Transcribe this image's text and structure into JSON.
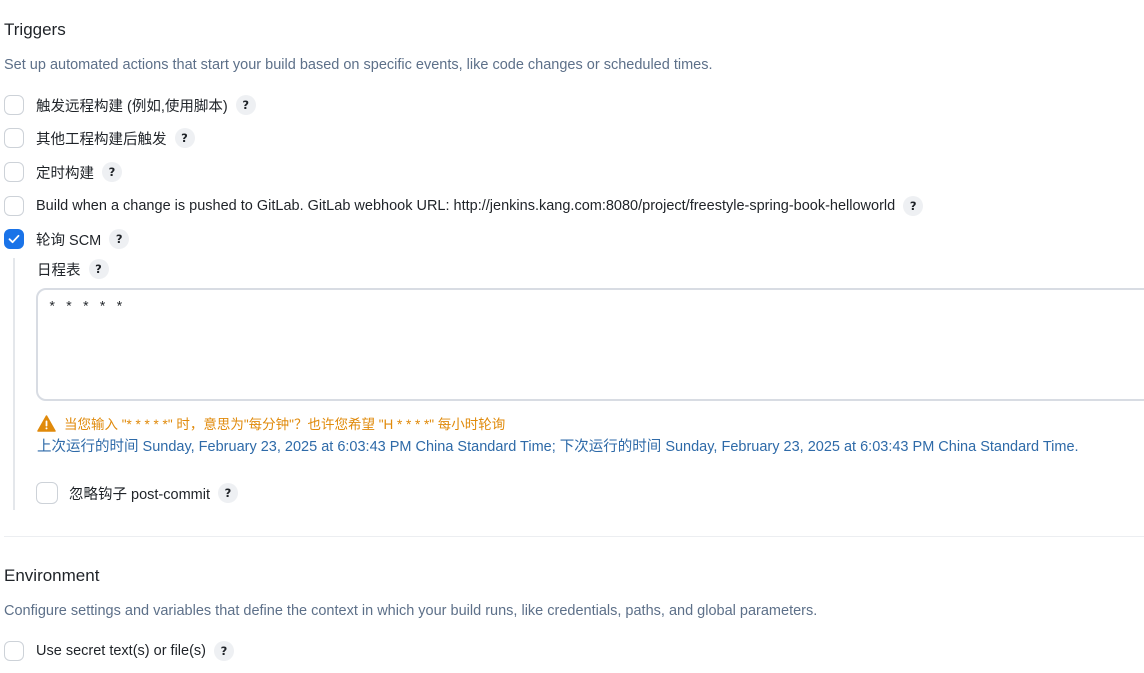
{
  "triggers": {
    "title": "Triggers",
    "description": "Set up automated actions that start your build based on specific events, like code changes or scheduled times.",
    "options": [
      {
        "label": "触发远程构建 (例如,使用脚本)",
        "checked": false
      },
      {
        "label": "其他工程构建后触发",
        "checked": false
      },
      {
        "label": "定时构建",
        "checked": false
      },
      {
        "label": "Build when a change is pushed to GitLab. GitLab webhook URL: http://jenkins.kang.com:8080/project/freestyle-spring-book-helloworld",
        "checked": false
      },
      {
        "label": "轮询 SCM",
        "checked": true
      }
    ],
    "help_symbol": "?",
    "scm": {
      "schedule_label": "日程表",
      "schedule_value": "* * * * *",
      "warning": "当您输入 \"* * * * *\" 时，意思为\"每分钟\"？也许您希望 \"H * * * *\" 每小时轮询",
      "run_info": "上次运行的时间 Sunday, February 23, 2025 at 6:03:43 PM China Standard Time; 下次运行的时间 Sunday, February 23, 2025 at 6:03:43 PM China Standard Time.",
      "ignore_hooks_label": "忽略钩子 post-commit"
    }
  },
  "environment": {
    "title": "Environment",
    "description": "Configure settings and variables that define the context in which your build runs, like credentials, paths, and global parameters.",
    "options": [
      {
        "label": "Use secret text(s) or file(s)",
        "checked": false
      }
    ]
  },
  "colors": {
    "accent": "#1a73e8",
    "warning": "#e08a0b",
    "info": "#2e6aa8",
    "description": "#5d7089"
  }
}
